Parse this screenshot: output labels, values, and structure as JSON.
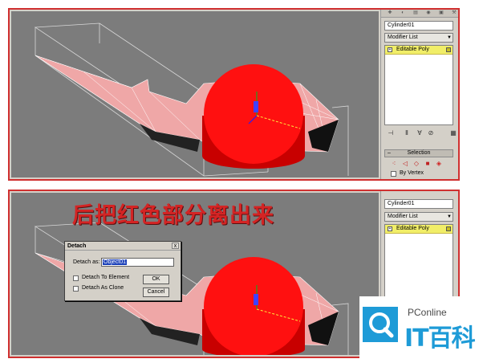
{
  "top_panel": {
    "command_panel": {
      "object_name": "Cylinder01",
      "modifier_list": "Modifier List",
      "modifier_stack": [
        "Editable Poly"
      ],
      "selection_rollout": {
        "title": "Selection",
        "by_vertex_label": "By Vertex"
      }
    }
  },
  "bottom_panel": {
    "caption": "后把红色部分离出来",
    "command_panel": {
      "object_name": "Cylinder01",
      "modifier_list": "Modifier List",
      "modifier_stack": [
        "Editable Poly"
      ]
    },
    "detach_dialog": {
      "title": "Detach",
      "close_glyph": "x",
      "detach_as_label": "Detach as:",
      "detach_as_value": "Object01",
      "to_element_label": "Detach To Element",
      "as_clone_label": "Detach As Clone",
      "ok_label": "OK",
      "cancel_label": "Cancel"
    }
  },
  "watermark": {
    "brand": "PConline",
    "product": "IT百科"
  },
  "icons": {
    "tab_icons": [
      "create-icon",
      "modify-icon",
      "hierarchy-icon",
      "motion-icon"
    ],
    "stack_tools": [
      "pin-stack-icon",
      "show-end-result-icon",
      "make-unique-icon",
      "remove-modifier-icon",
      "configure-sets-icon"
    ],
    "subobject_modes": [
      "vertex-icon",
      "edge-icon",
      "border-icon",
      "polygon-icon",
      "element-icon"
    ]
  },
  "colors": {
    "panel_border": "#d03030",
    "viewport_bg": "#7c7c7c",
    "selected_face": "#ff1010",
    "mesh_face": "#f0a8a8",
    "stack_highlight": "#f1ee68",
    "caption": "#d42424",
    "brand_blue": "#1e9bd7"
  }
}
